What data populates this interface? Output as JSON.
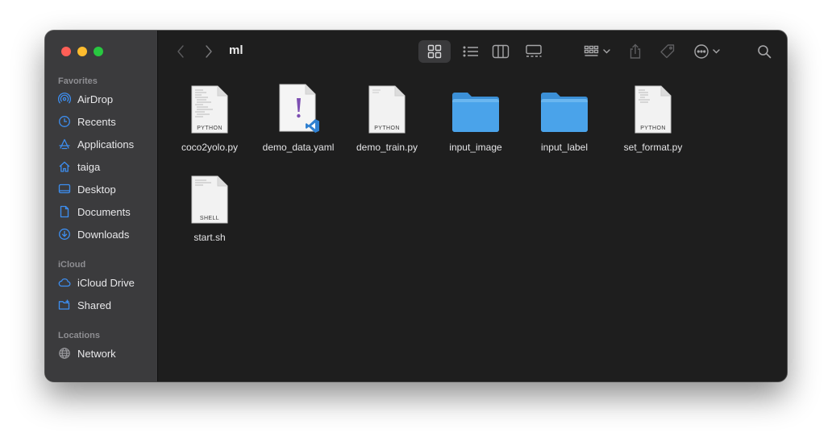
{
  "window": {
    "title": "ml"
  },
  "sidebar": {
    "favorites_title": "Favorites",
    "favorites": [
      {
        "label": "AirDrop",
        "icon": "airdrop-icon"
      },
      {
        "label": "Recents",
        "icon": "clock-icon"
      },
      {
        "label": "Applications",
        "icon": "applications-icon"
      },
      {
        "label": "taiga",
        "icon": "home-icon"
      },
      {
        "label": "Desktop",
        "icon": "desktop-icon"
      },
      {
        "label": "Documents",
        "icon": "document-icon"
      },
      {
        "label": "Downloads",
        "icon": "download-icon"
      }
    ],
    "icloud_title": "iCloud",
    "icloud": [
      {
        "label": "iCloud Drive",
        "icon": "cloud-icon"
      },
      {
        "label": "Shared",
        "icon": "shared-folder-icon"
      }
    ],
    "locations_title": "Locations",
    "locations": [
      {
        "label": "Network",
        "icon": "globe-icon"
      }
    ]
  },
  "files": [
    {
      "name": "coco2yolo.py",
      "kind": "python",
      "tag": "PYTHON"
    },
    {
      "name": "demo_data.yaml",
      "kind": "yaml",
      "tag": "!"
    },
    {
      "name": "demo_train.py",
      "kind": "python",
      "tag": "PYTHON"
    },
    {
      "name": "input_image",
      "kind": "folder",
      "tag": ""
    },
    {
      "name": "input_label",
      "kind": "folder",
      "tag": ""
    },
    {
      "name": "set_format.py",
      "kind": "python",
      "tag": "PYTHON"
    },
    {
      "name": "start.sh",
      "kind": "shell",
      "tag": "SHELL"
    }
  ],
  "colors": {
    "folder": "#4aa3ea",
    "accent": "#3d8ef0",
    "sidebar_icon": "#3d8ef0"
  }
}
